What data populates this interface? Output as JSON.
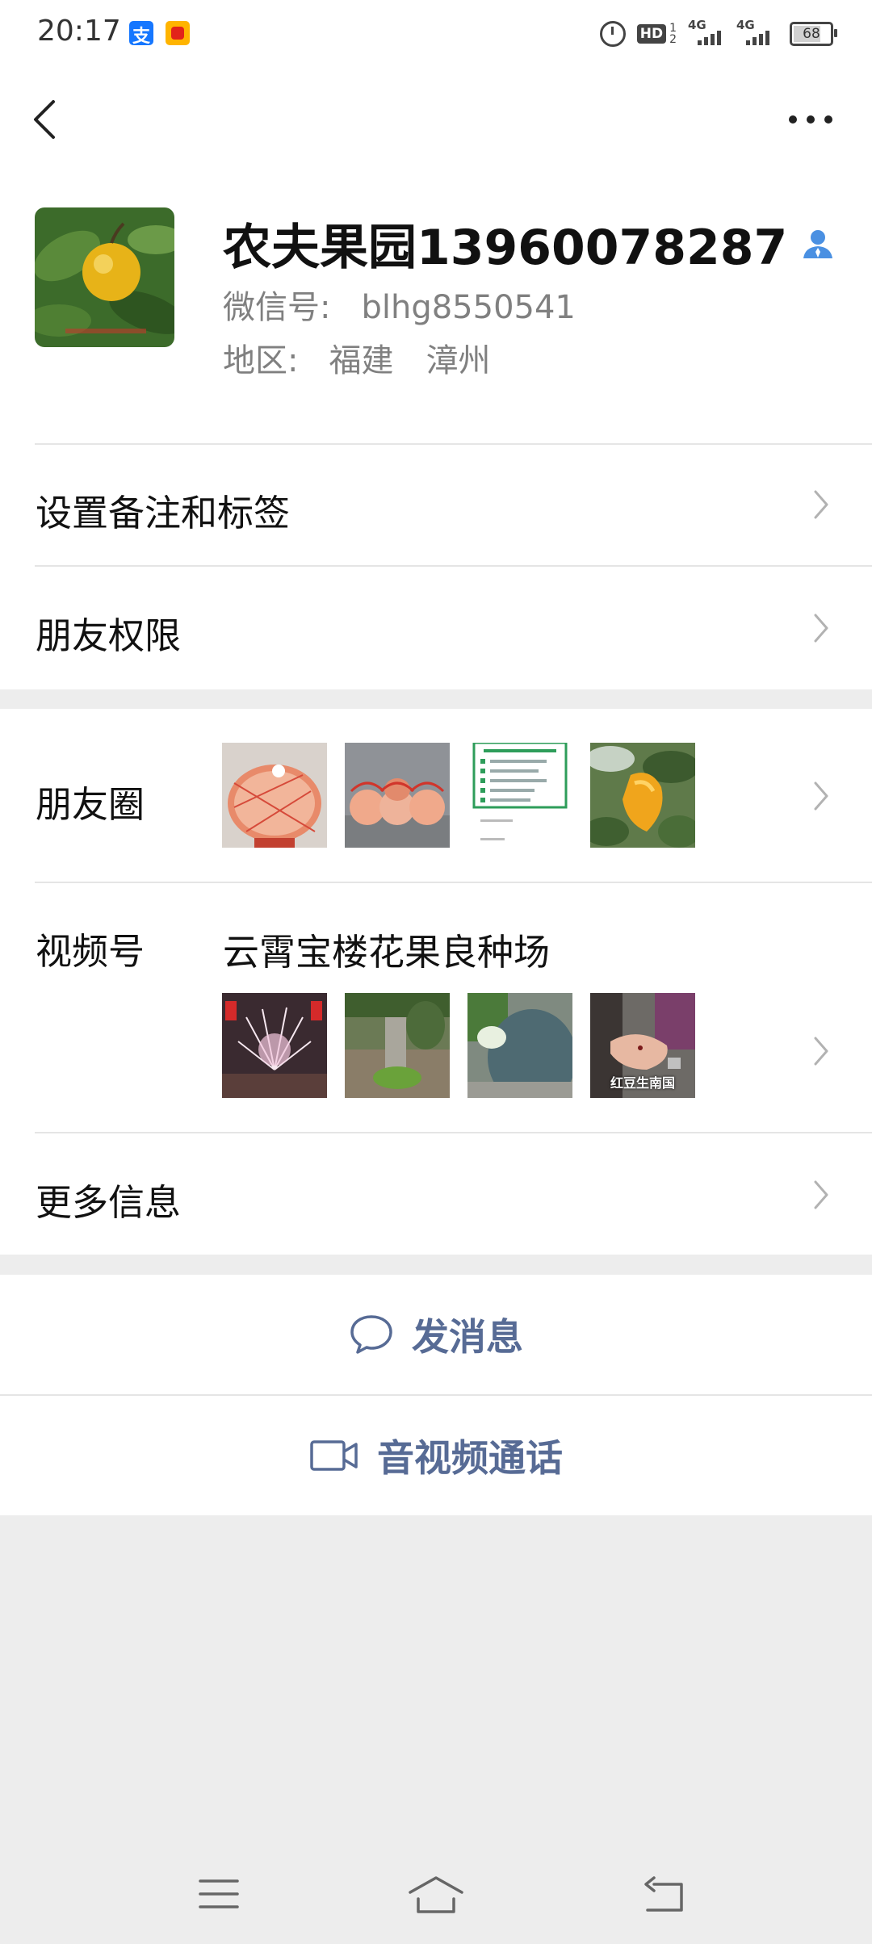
{
  "status_bar": {
    "time": "20:17",
    "hd_label": "HD",
    "hd_sim": [
      "1",
      "2"
    ],
    "net1": "4G",
    "net2": "4G",
    "battery": "68",
    "icons": [
      "alipay-icon",
      "taobao-icon",
      "alarm-icon",
      "signal-icon",
      "battery-icon"
    ]
  },
  "nav": {
    "back_icon": "chevron-left-icon",
    "more_icon": "more-dots-icon"
  },
  "profile": {
    "name": "农夫果园13960078287",
    "wechat_id_label": "微信号:",
    "wechat_id": "blhg8550541",
    "region_label": "地区:",
    "region_province": "福建",
    "region_city": "漳州",
    "verified_icon": "person-verified-icon"
  },
  "rows": {
    "remark": "设置备注和标签",
    "permissions": "朋友权限",
    "moments": "朋友圈",
    "channels": "视频号",
    "channel_name": "云霄宝楼花果良种场",
    "channel_thumb_caption": "红豆生南国",
    "more_info": "更多信息"
  },
  "actions": {
    "send_message": "发消息",
    "av_call": "音视频通话"
  },
  "colors": {
    "link_blue": "#576b95",
    "background": "#ededed",
    "verified_blue": "#4a90e2"
  }
}
